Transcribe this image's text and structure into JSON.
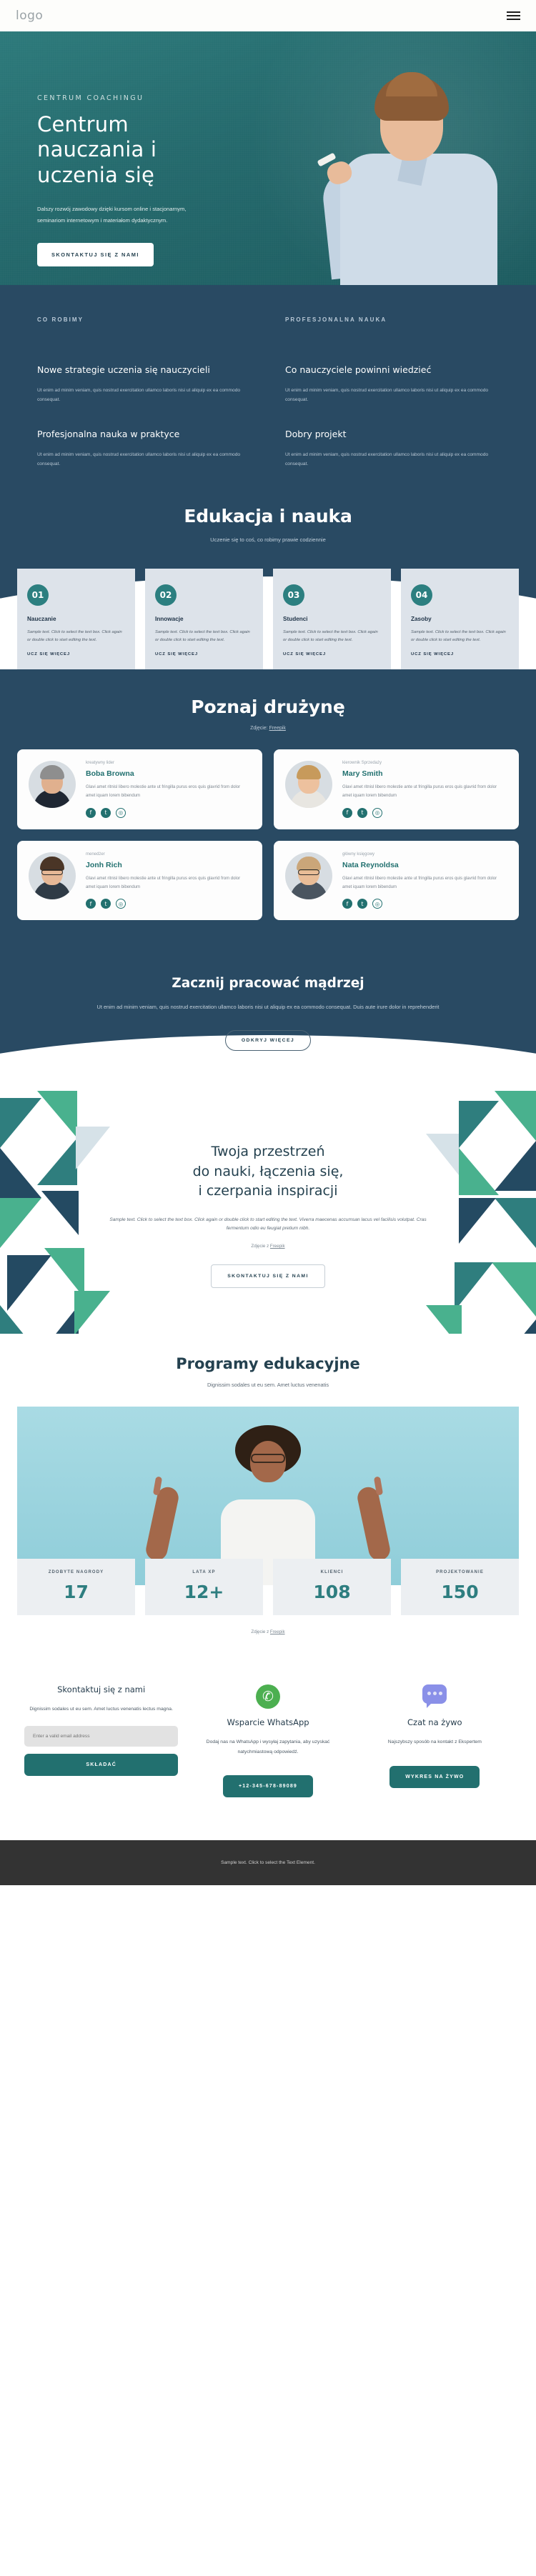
{
  "header": {
    "logo": "logo",
    "menu_icon": "hamburger-icon"
  },
  "hero": {
    "eyebrow": "CENTRUM COACHINGU",
    "title_line1": "Centrum",
    "title_line2": "nauczania i",
    "title_line3": "uczenia się",
    "description": "Dalszy rozwój zawodowy dzięki kursom online i stacjonarnym, seminariom internetowym i materiałom dydaktycznym.",
    "cta": "SKONTAKTUJ SIĘ Z NAMI"
  },
  "what_we_do": {
    "label_left": "CO ROBIMY",
    "label_right": "PROFESJONALNA NAUKA",
    "body": "Ut enim ad minim veniam, quis nostrud exercitation ullamco laboris nisi ut aliquip ex ea commodo consequat.",
    "items": [
      {
        "title": "Nowe strategie uczenia się nauczycieli"
      },
      {
        "title": "Co nauczyciele powinni wiedzieć"
      },
      {
        "title": "Profesjonalna nauka w praktyce"
      },
      {
        "title": "Dobry projekt"
      }
    ]
  },
  "education": {
    "title": "Edukacja i nauka",
    "subtitle": "Uczenie się to coś, co robimy prawie codziennie",
    "card_body": "Sample text. Click to select the text box. Click again or double click to start editing the text.",
    "card_link": "UCZ SIĘ WIĘCEJ",
    "cards": [
      {
        "num": "01",
        "title": "Nauczanie"
      },
      {
        "num": "02",
        "title": "Innowacje"
      },
      {
        "num": "03",
        "title": "Studenci"
      },
      {
        "num": "04",
        "title": "Zasoby"
      }
    ]
  },
  "team": {
    "title": "Poznaj drużynę",
    "credit_prefix": "Zdjęcie:",
    "credit_link": "Freepik",
    "member_desc": "Glavi amet ritnisl libero molestie ante ut fringilla purus eros quis glavrid from dolor amet iquam lorem bibendum",
    "members": [
      {
        "role": "kreatywny lider",
        "name": "Boba Browna"
      },
      {
        "role": "kierownik Sprzedaży",
        "name": "Mary Smith"
      },
      {
        "role": "menedżer",
        "name": "Jonh Rich"
      },
      {
        "role": "główny księgowy",
        "name": "Nata Reynoldsa"
      }
    ],
    "socials": [
      "facebook-icon",
      "twitter-icon",
      "instagram-icon"
    ]
  },
  "smarter": {
    "title": "Zacznij pracować mądrzej",
    "body": "Ut enim ad minim veniam, quis nostrud exercitation ullamco laboris nisi ut aliquip ex ea commodo consequat. Duis aute irure dolor in reprehenderit",
    "cta": "ODKRYJ WIĘCEJ"
  },
  "inspire": {
    "title_line1": "Twoja przestrzeń",
    "title_line2": "do nauki, łączenia się,",
    "title_line3": "i czerpania inspiracji",
    "body": "Sample text. Click to select the text box. Click again or double click to start editing the text. Viverra maecenas accumsan lacus vel facilisis volutpat. Cras fermentum odio eu feugiat pretium nibh.",
    "credit_prefix": "Zdjęcie z",
    "credit_link": "Freepik",
    "cta": "SKONTAKTUJ SIĘ Z NAMI"
  },
  "programs": {
    "title": "Programy edukacyjne",
    "subtitle": "Dignissim sodales ut eu sem. Amet luctus venenatis",
    "credit_prefix": "Zdjęcie z",
    "credit_link": "Freepik",
    "stats": [
      {
        "label": "ZDOBYTE NAGRODY",
        "value": "17"
      },
      {
        "label": "LATA XP",
        "value": "12+"
      },
      {
        "label": "KLIENCI",
        "value": "108"
      },
      {
        "label": "PROJEKTOWANIE",
        "value": "150"
      }
    ]
  },
  "contact": {
    "form": {
      "title": "Skontaktuj się z nami",
      "body": "Dignissim sodales ut eu sem. Amet luctus venenatis lectus magna.",
      "email_placeholder": "Enter a valid email address",
      "submit": "SKŁADAĆ"
    },
    "whatsapp": {
      "icon": "whatsapp-icon",
      "title": "Wsparcie WhatsApp",
      "body": "Dodaj nas na WhatsApp i wysyłaj zapytania, aby uzyskać natychmiastową odpowiedź.",
      "phone": "+12-345-678-89089"
    },
    "chat": {
      "icon": "chat-bubble-icon",
      "title": "Czat na żywo",
      "body": "Najszybszy sposób na kontakt z Ekspertem",
      "cta": "WYKRES NA ŻYWO"
    }
  },
  "footer": {
    "text": "Sample text. Click to select the Text Element."
  },
  "colors": {
    "teal": "#22706f",
    "navy": "#294a63",
    "hero_teal": "#24696c",
    "card_grey": "#dde3ea",
    "footer_dark": "#333333",
    "whatsapp_green": "#4caf50",
    "chat_purple": "#8a90e8"
  }
}
